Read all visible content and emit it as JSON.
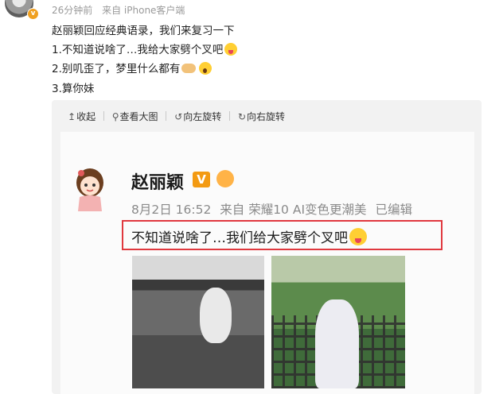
{
  "header": {
    "time": "26分钟前",
    "source": "来自 iPhone客户端"
  },
  "post": {
    "line1": "赵丽颖回应经典语录，我们来复习一下",
    "line2": "1.不知道说啥了…我给大家劈个叉吧",
    "line3": "2.别叽歪了，梦里什么都有",
    "line4": "3.算你妹"
  },
  "toolbar": {
    "collapse": "收起",
    "view_large": "查看大图",
    "rotate_left": "向左旋转",
    "rotate_right": "向右旋转"
  },
  "screenshot": {
    "name": "赵丽颖",
    "vip_badge": "V",
    "date_time": "8月2日 16:52",
    "source": "来自 荣耀10 AI变色更潮美",
    "edited": "已编辑",
    "text": "不知道说啥了…我们给大家劈个叉吧"
  },
  "colors": {
    "highlight_border": "#e0383e",
    "vip_orange": "#f39a12"
  },
  "icons": [
    "avatar",
    "verified-badge-icon",
    "tongue-emoji-icon",
    "handshake-icon",
    "shock-emoji-icon",
    "collapse-icon",
    "zoom-icon",
    "rotate-left-icon",
    "rotate-right-icon",
    "crown-icon"
  ]
}
